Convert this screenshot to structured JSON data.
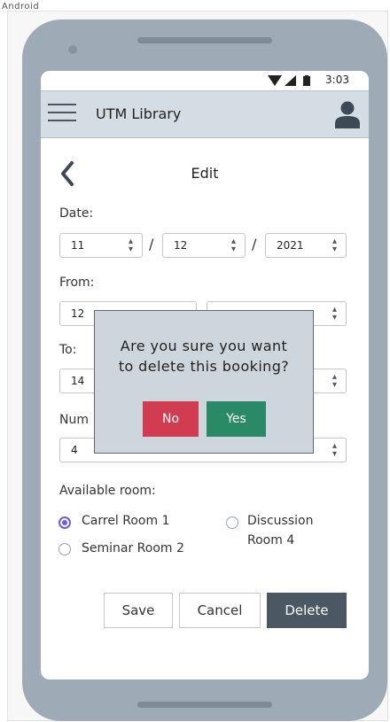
{
  "frame": {
    "label": "Android"
  },
  "status_bar": {
    "time": "3:03"
  },
  "app_bar": {
    "title": "UTM Library"
  },
  "page": {
    "title": "Edit"
  },
  "form": {
    "date_label": "Date:",
    "date_day": "11",
    "date_month": "12",
    "date_year": "2021",
    "date_separator": "/",
    "from_label": "From:",
    "from_hour": "12",
    "to_label": "To:",
    "to_hour": "14",
    "number_label": "Num",
    "number_value": "4",
    "available_room_label": "Available room:",
    "rooms": [
      {
        "label": "Carrel Room 1",
        "selected": true
      },
      {
        "label": "Seminar Room 2",
        "selected": false
      },
      {
        "label_line1": "Discussion",
        "label_line2": "Room 4",
        "selected": false
      }
    ]
  },
  "actions": {
    "save": "Save",
    "cancel": "Cancel",
    "delete": "Delete"
  },
  "dialog": {
    "line1": "Are you sure you want",
    "line2": "to delete this booking?",
    "no": "No",
    "yes": "Yes"
  },
  "colors": {
    "accent": "#6c5ce7",
    "no_button": "#d23c50",
    "yes_button": "#2a8a68",
    "delete_button": "#4b5864",
    "app_bar": "#d4dde3",
    "phone_body": "#9eabb6"
  },
  "icons": {
    "menu": "hamburger-icon",
    "user": "user-icon",
    "back": "chevron-left-icon",
    "select_arrow": "up-down-arrows-icon",
    "wifi": "wifi-icon",
    "signal": "signal-icon",
    "battery": "battery-icon"
  }
}
